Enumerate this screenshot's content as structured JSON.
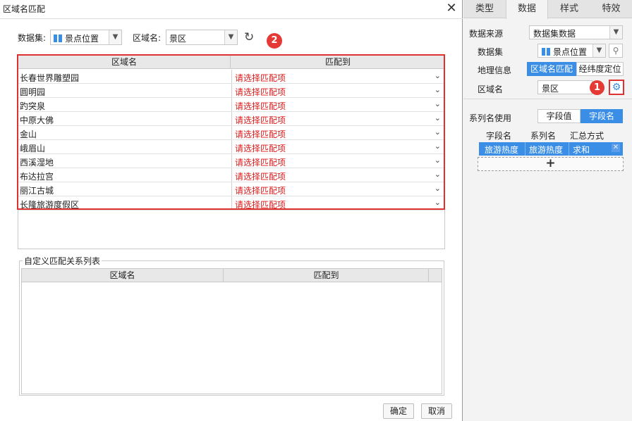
{
  "dialog": {
    "title": "区域名匹配",
    "close_glyph": "✕",
    "dataset_label": "数据集:",
    "dataset_value": "景点位置",
    "region_label": "区域名:",
    "region_value": "景区",
    "badge2": "2",
    "grid": {
      "col_region": "区域名",
      "col_match": "匹配到",
      "placeholder": "请选择匹配项",
      "rows": [
        "长春世界雕塑园",
        "圆明园",
        "趵突泉",
        "中原大佛",
        "金山",
        "峨眉山",
        "西溪湿地",
        "布达拉宫",
        "丽江古城",
        "长隆旅游度假区"
      ]
    },
    "custom": {
      "title": "自定义匹配关系列表",
      "col_region": "区域名",
      "col_match": "匹配到"
    },
    "ok_label": "确定",
    "cancel_label": "取消"
  },
  "panel": {
    "tabs": [
      "类型",
      "数据",
      "样式",
      "特效"
    ],
    "active_tab": "数据",
    "source_label": "数据来源",
    "source_value": "数据集数据",
    "dataset_label": "数据集",
    "dataset_value": "景点位置",
    "geo_label": "地理信息",
    "geo_opt1": "区域名匹配",
    "geo_opt2": "经纬度定位",
    "region_label": "区域名",
    "region_value": "景区",
    "badge1": "1",
    "series_label": "系列名使用",
    "series_opt1": "字段值",
    "series_opt2": "字段名",
    "table": {
      "h1": "字段名",
      "h2": "系列名",
      "h3": "汇总方式",
      "r1": "旅游热度",
      "r2": "旅游热度",
      "r3": "求和"
    },
    "add_glyph": "+"
  },
  "colors": {
    "accent": "#3a8ee6",
    "highlight": "#e03131",
    "placeholder_text": "#d71b1b"
  }
}
